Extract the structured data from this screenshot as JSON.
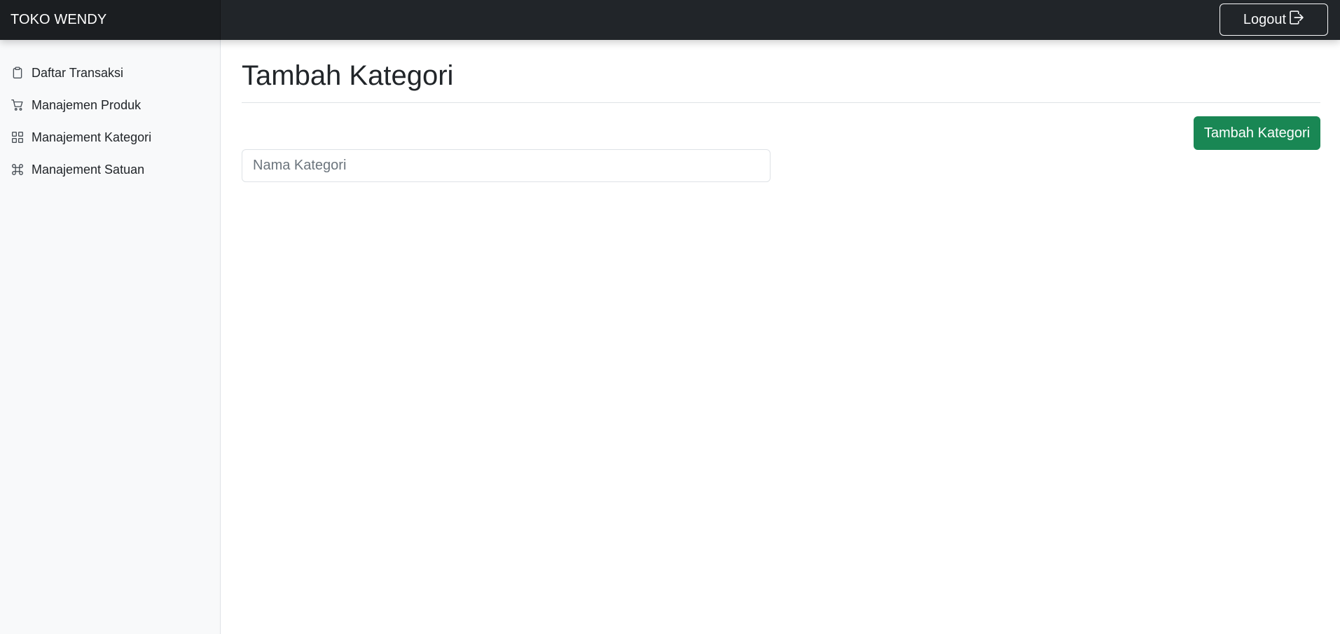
{
  "navbar": {
    "brand": "TOKO WENDY",
    "logout_label": "Logout",
    "logout_icon": "box-arrow-right-icon"
  },
  "sidebar": {
    "items": [
      {
        "label": "Daftar Transaksi",
        "icon": "clipboard-icon"
      },
      {
        "label": "Manajemen Produk",
        "icon": "cart-icon"
      },
      {
        "label": "Manajement Kategori",
        "icon": "grid-icon"
      },
      {
        "label": "Manajement Satuan",
        "icon": "command-icon"
      }
    ]
  },
  "main": {
    "title": "Tambah Kategori",
    "add_button_label": "Tambah Kategori",
    "name_input": {
      "placeholder": "Nama Kategori",
      "value": ""
    }
  },
  "colors": {
    "navbar_bg": "#212529",
    "sidebar_bg": "#f8f9fa",
    "success": "#198754"
  }
}
